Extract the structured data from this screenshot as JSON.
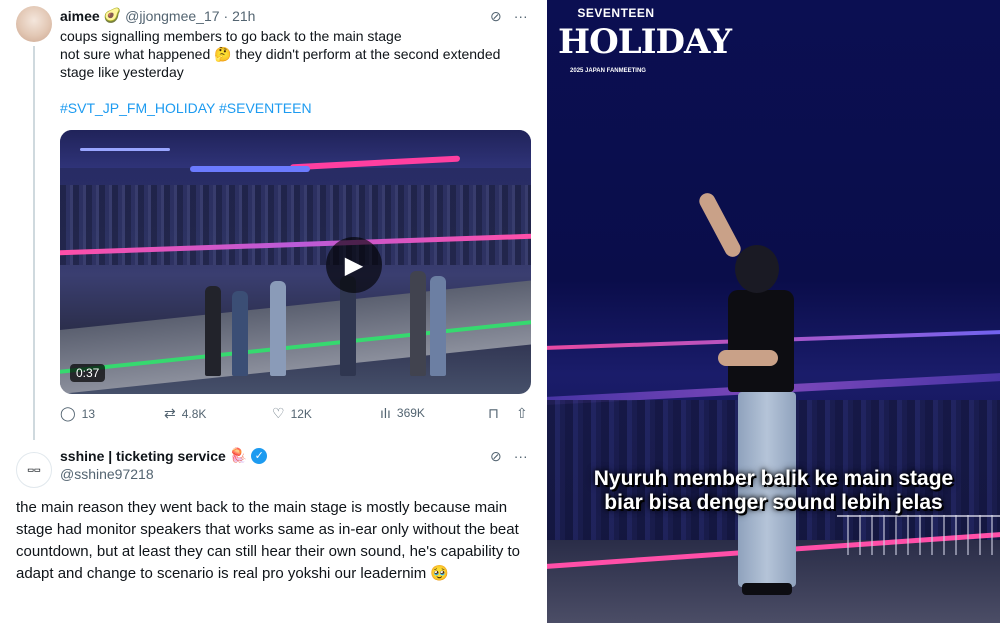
{
  "tweet1": {
    "name": "aimee",
    "handle": "@jjongmee_17",
    "time": "· 21h",
    "line1": "coups signalling members to go back to the main stage",
    "line2a": "not sure what happened",
    "line2b": "they didn't perform at the second extended",
    "line3": "stage like yesterday",
    "hashtags": "#SVT_JP_FM_HOLIDAY #SEVENTEEN",
    "video": {
      "duration": "0:37"
    },
    "actions": {
      "replies": "13",
      "reposts": "4.8K",
      "likes": "12K",
      "views": "369K"
    }
  },
  "tweet2": {
    "name": "sshine | ticketing service",
    "handle": "@sshine97218",
    "text": "the main reason they went back to the main stage is mostly because main stage had monitor speakers that works same as in-ear only without the beat countdown, but at least they can still hear their own sound, he's capability to adapt and change to scenario is real pro yokshi our leadernim",
    "emoji": "🥹"
  },
  "right_panel": {
    "logo_top": "SEVENTEEN",
    "logo_main": "HOLIDAY",
    "logo_sub": "2025 JAPAN FANMEETING",
    "subtitle_line1": "Nyuruh member balik ke main stage",
    "subtitle_line2": "biar bisa denger sound lebih jelas"
  },
  "icons": [
    "grok-icon",
    "more-icon",
    "reply-icon",
    "repost-icon",
    "like-icon",
    "views-icon",
    "bookmark-icon",
    "share-icon",
    "verified-icon",
    "play-icon"
  ],
  "colors": {
    "link": "#1d9bf0",
    "muted": "#536471",
    "verified": "#1d9bf0"
  }
}
